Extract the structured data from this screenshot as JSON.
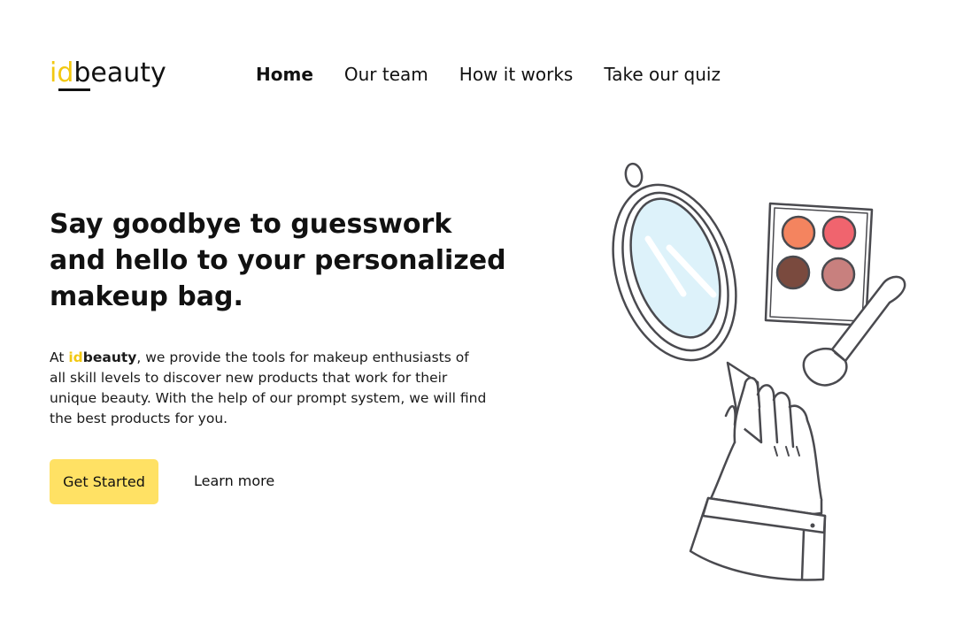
{
  "brand": {
    "logo_prefix": "id",
    "logo_suffix": "beauty",
    "accent_color": "#F2C811",
    "button_color": "#FFE164"
  },
  "nav": {
    "items": [
      {
        "label": "Home",
        "active": true
      },
      {
        "label": "Our team",
        "active": false
      },
      {
        "label": "How it works",
        "active": false
      },
      {
        "label": "Take our quiz",
        "active": false
      }
    ]
  },
  "hero": {
    "headline_lines": [
      "Say goodbye to guesswork",
      "and hello to your personalized",
      "makeup bag."
    ],
    "desc_before": "At ",
    "desc_brand_prefix": "id",
    "desc_brand_suffix": "beauty",
    "desc_after": ", we provide the tools for makeup enthusiasts of all skill levels to discover new products that work for their unique beauty. With the help of our prompt system, we will find the best products for you.",
    "primary_button": "Get Started",
    "secondary_link": "Learn more"
  },
  "illustration": {
    "description_icon": "mirror-makeup-palette-illustration",
    "palette_colors": [
      "#F4845F",
      "#F0646E",
      "#7A4A3E",
      "#C8807E"
    ],
    "mirror_glass_color": "#DDF2FA"
  }
}
